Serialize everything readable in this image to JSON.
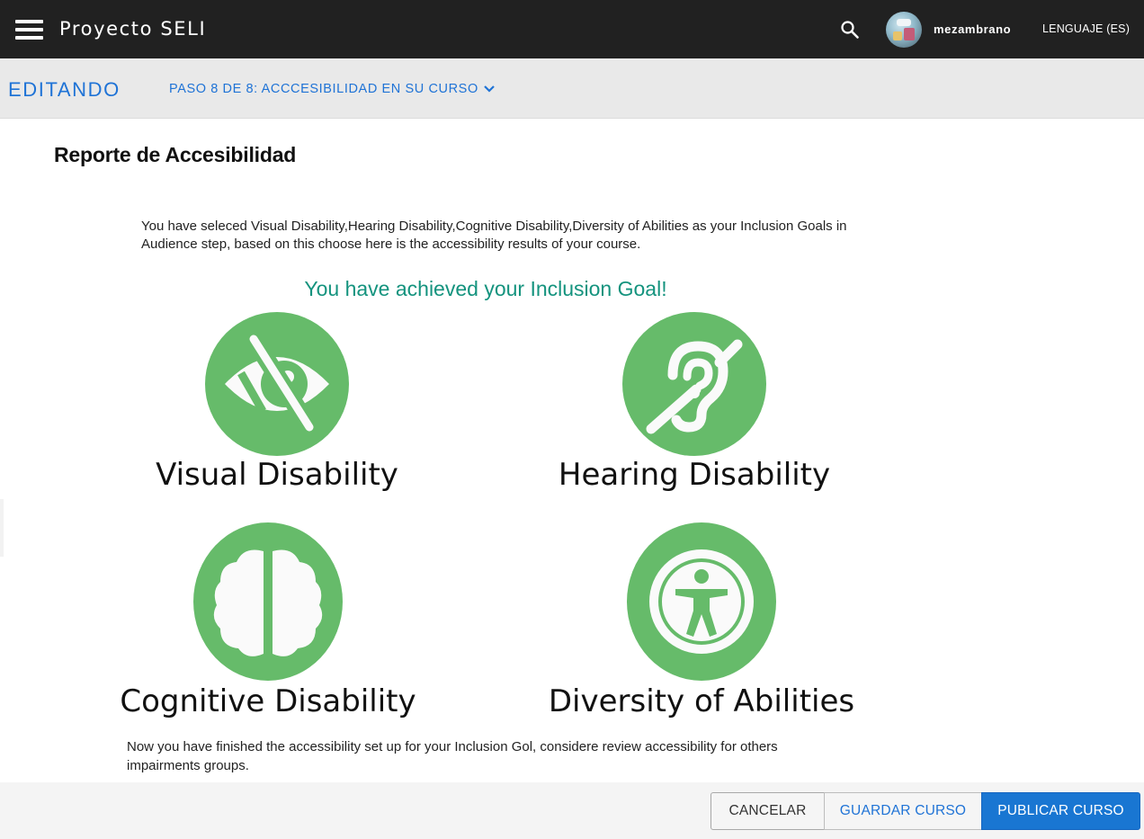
{
  "app": {
    "title": "Proyecto SELI"
  },
  "header": {
    "username": "mezambrano",
    "language_label": "LENGUAJE (ES)"
  },
  "editor": {
    "mode_label": "EDITANDO",
    "step_label": "PASO 8 DE 8: ACCCESIBILIDAD EN SU CURSO"
  },
  "report": {
    "title": "Reporte de Accesibilidad",
    "intro": "You have seleced Visual Disability,Hearing Disability,Cognitive Disability,Diversity of Abilities as your Inclusion Goals in Audience step, based on this choose here is the accessibility results of your course.",
    "achieved": "You have achieved your Inclusion Goal!",
    "goals": [
      {
        "label": "Visual Disability",
        "icon": "eye-slash-icon"
      },
      {
        "label": "Hearing Disability",
        "icon": "ear-slash-icon"
      },
      {
        "label": "Cognitive Disability",
        "icon": "brain-icon"
      },
      {
        "label": "Diversity of Abilities",
        "icon": "universal-access-icon"
      }
    ],
    "outro": "Now you have finished the accessibility set up for your Inclusion Gol, considere review accessibility for others impairments groups."
  },
  "footer": {
    "cancel_label": "CANCELAR",
    "save_label": "GUARDAR CURSO",
    "publish_label": "PUBLICAR CURSO"
  },
  "colors": {
    "topbar": "#212121",
    "accent": "#1f73d6",
    "success_text": "#14937e",
    "goal_green": "#66bb6a",
    "publish": "#1976d2"
  }
}
